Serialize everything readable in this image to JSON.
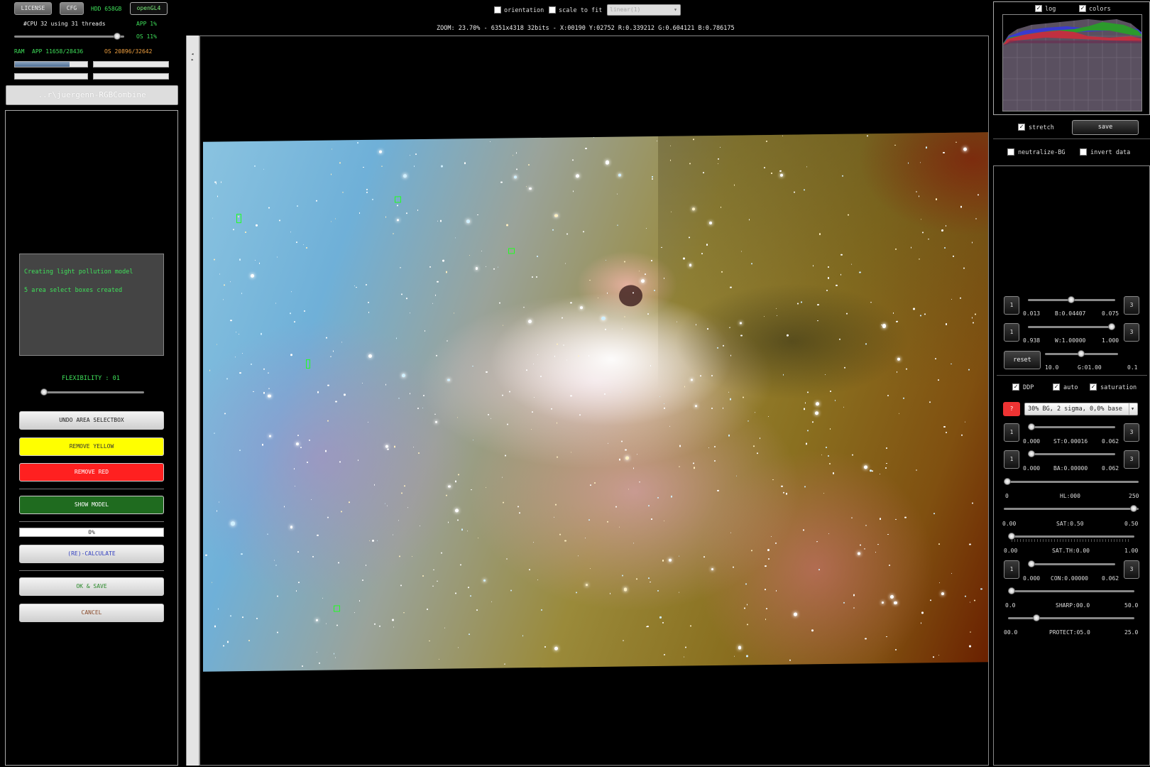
{
  "top_left": {
    "license_label": "LICENSE",
    "cfg_label": "CFG",
    "hdd_text": "HDD 658GB",
    "opengl_label": "openGL4",
    "cpu_text": "#CPU 32  using 31 threads",
    "app_cpu": "APP 1%",
    "os_cpu": "OS 11%",
    "ram_label": "RAM",
    "ram_app": "APP 11658/28436",
    "ram_os": "OS 20896/32642",
    "ram_app_fill": 0.75,
    "path_label": "..r\\juergenn-RGBCombine"
  },
  "left_panel": {
    "log_lines": [
      "Creating light pollution model",
      "5 area select boxes created"
    ],
    "flexibility_label": "FLEXIBILITY : 01",
    "flexibility_value": 0.02,
    "undo_label": "UNDO AREA SELECTBOX",
    "remove_yellow_label": "REMOVE YELLOW",
    "remove_red_label": "REMOVE RED",
    "show_model_label": "SHOW MODEL",
    "progress_label": "0%",
    "recalculate_label": "(RE)-CALCULATE",
    "ok_save_label": "OK & SAVE",
    "cancel_label": "CANCEL"
  },
  "top_bar": {
    "orientation_label": "orientation",
    "scale_to_fit_label": "scale to fit",
    "stretch_mode_value": "linear(1)",
    "info_line": "ZOOM: 23.70% - 6351x4318 32bits - X:00190 Y:02752 R:0.339212 G:0.604121 B:0.786175"
  },
  "histogram": {
    "log_label": "log",
    "colors_label": "colors",
    "log_checked": true,
    "colors_checked": true
  },
  "right_panel": {
    "stretch_label": "stretch",
    "save_label": "save",
    "neutralize_label": "neutralize-BG",
    "invert_label": "invert data",
    "btn_1": "1",
    "btn_3": "3",
    "reset_label": "reset",
    "b_row": {
      "min": "0.013",
      "label": "B:0.04407",
      "max": "0.075",
      "pos": 0.5
    },
    "w_row": {
      "min": "0.938",
      "label": "W:1.00000",
      "max": "1.000",
      "pos": 0.98
    },
    "g_row": {
      "min": "10.0",
      "label": "G:01.00",
      "max": "0.1",
      "pos": 0.5
    },
    "ddp_label": "DDP",
    "auto_label": "auto",
    "saturation_label": "saturation",
    "help_label": "?",
    "preset_value": "30% BG, 2 sigma, 0,0% base",
    "st_row": {
      "min": "0.000",
      "label": "ST:0.00016",
      "max": "0.062",
      "pos": 0.0
    },
    "ba_row": {
      "min": "0.000",
      "label": "BA:0.00000",
      "max": "0.062",
      "pos": 0.0
    },
    "hl_row": {
      "min": "0",
      "label": "HL:000",
      "max": "250",
      "pos": 0.0
    },
    "sat_row": {
      "min": "0.00",
      "label": "SAT:0.50",
      "max": "0.50",
      "pos": 1.0
    },
    "satth_row": {
      "min": "0.00",
      "label": "SAT.TH:0.00",
      "max": "1.00",
      "pos": 0.0
    },
    "con_row": {
      "min": "0.000",
      "label": "CON:0.00000",
      "max": "0.062",
      "pos": 0.0
    },
    "sharp_row": {
      "min": "0.0",
      "label": "SHARP:00.0",
      "max": "50.0",
      "pos": 0.0
    },
    "protect_row": {
      "min": "00.0",
      "label": "PROTECT:05.0",
      "max": "25.0",
      "pos": 0.2
    }
  }
}
